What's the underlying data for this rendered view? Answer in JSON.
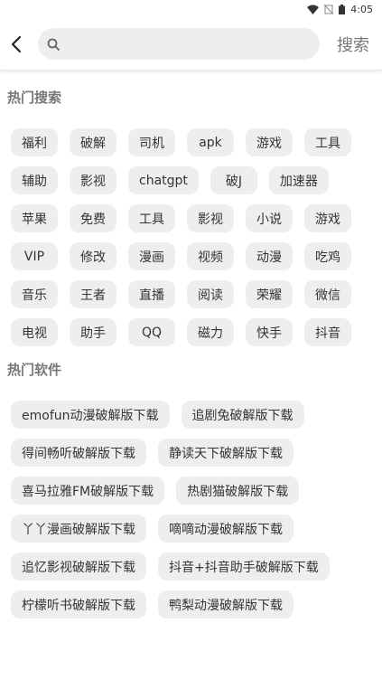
{
  "status": {
    "time": "4:05"
  },
  "search": {
    "placeholder": "",
    "button_label": "搜索"
  },
  "hot_search": {
    "title": "热门搜索",
    "tags": [
      "福利",
      "破解",
      "司机",
      "apk",
      "游戏",
      "工具",
      "辅助",
      "影视",
      "chatgpt",
      "破J",
      "加速器",
      "苹果",
      "免费",
      "工具",
      "影视",
      "小说",
      "游戏",
      "VIP",
      "修改",
      "漫画",
      "视频",
      "动漫",
      "吃鸡",
      "音乐",
      "王者",
      "直播",
      "阅读",
      "荣耀",
      "微信",
      "电视",
      "助手",
      "QQ",
      "磁力",
      "快手",
      "抖音"
    ]
  },
  "hot_software": {
    "title": "热门软件",
    "items": [
      "emofun动漫破解版下载",
      "追剧兔破解版下载",
      "得间畅听破解版下载",
      "静读天下破解版下载",
      "喜马拉雅FM破解版下载",
      "热剧猫破解版下载",
      "丫丫漫画破解版下载",
      "嘀嘀动漫破解版下载",
      "追忆影视破解版下载",
      "抖音+抖音助手破解版下载",
      "柠檬听书破解版下载",
      "鸭梨动漫破解版下载"
    ]
  },
  "colors": {
    "tag_bg": "#eeeeee",
    "title_gray": "#777777"
  }
}
